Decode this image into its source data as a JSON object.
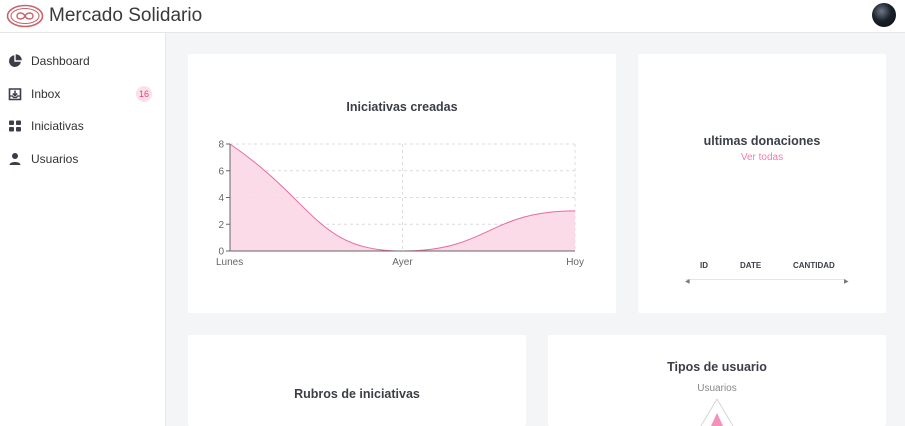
{
  "header": {
    "brand": "Mercado Solidario",
    "logo_icon": "infinity-heart-logo",
    "avatar_icon": "user-avatar"
  },
  "sidebar": {
    "items": [
      {
        "label": "Dashboard",
        "icon": "pie-chart-icon"
      },
      {
        "label": "Inbox",
        "icon": "inbox-icon",
        "badge": "16"
      },
      {
        "label": "Iniciativas",
        "icon": "grid-icon"
      },
      {
        "label": "Usuarios",
        "icon": "user-icon"
      }
    ]
  },
  "cards": {
    "iniciativas": {
      "title": "Iniciativas creadas"
    },
    "donaciones": {
      "title": "ultimas donaciones",
      "link": "Ver todas",
      "columns": [
        "ID",
        "DATE",
        "CANTIDAD"
      ]
    },
    "rubros": {
      "title": "Rubros de iniciativas"
    },
    "tipos": {
      "title": "Tipos de usuario",
      "subtitle": "Usuarios"
    }
  },
  "colors": {
    "accent": "#f27cad",
    "area_fill": "#fbd7e6",
    "line": "#e869a3"
  },
  "chart_data": [
    {
      "type": "area",
      "title": "Iniciativas creadas",
      "categories": [
        "Lunes",
        "Ayer",
        "Hoy"
      ],
      "series": [
        {
          "values": [
            8,
            0,
            3
          ]
        }
      ],
      "y_ticks": [
        "0",
        "2",
        "4",
        "6",
        "8"
      ],
      "ylim": [
        0,
        8
      ],
      "grid": true
    },
    {
      "type": "radar",
      "title": "Tipos de usuario",
      "series": [
        {
          "name": "Usuarios"
        }
      ]
    }
  ]
}
